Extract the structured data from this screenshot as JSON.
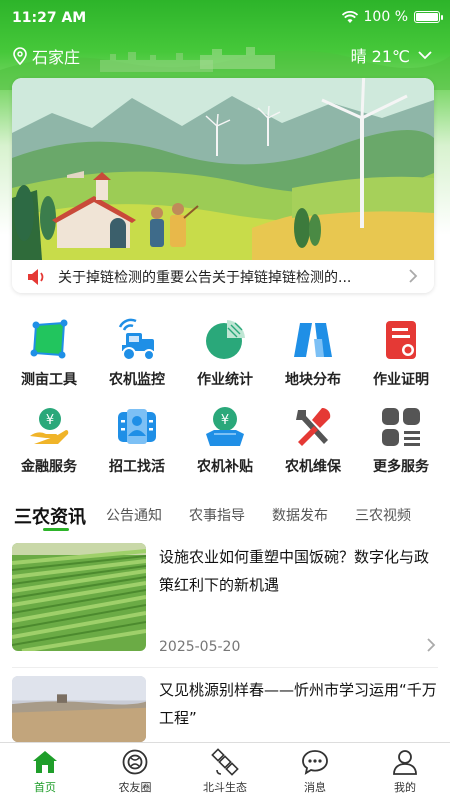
{
  "status_bar": {
    "time": "11:27 AM",
    "battery": "100 %"
  },
  "location": {
    "city": "石家庄",
    "weather": "晴 21℃"
  },
  "banner": {
    "notice_text": "关于掉链检测的重要公告关于掉链掉链检测的..."
  },
  "services": [
    {
      "label": "测亩工具",
      "icon": "field-measure-icon"
    },
    {
      "label": "农机监控",
      "icon": "tractor-monitor-icon"
    },
    {
      "label": "作业统计",
      "icon": "pie-chart-icon"
    },
    {
      "label": "地块分布",
      "icon": "plot-map-icon"
    },
    {
      "label": "作业证明",
      "icon": "certificate-icon"
    },
    {
      "label": "金融服务",
      "icon": "finance-icon"
    },
    {
      "label": "招工找活",
      "icon": "recruit-icon"
    },
    {
      "label": "农机补贴",
      "icon": "subsidy-icon"
    },
    {
      "label": "农机维保",
      "icon": "repair-tools-icon"
    },
    {
      "label": "更多服务",
      "icon": "more-services-icon"
    }
  ],
  "news_tabs": [
    "三农资讯",
    "公告通知",
    "农事指导",
    "数据发布",
    "三农视频"
  ],
  "news": [
    {
      "title": "设施农业如何重塑中国饭碗？数字化与政策红利下的新机遇",
      "date": "2025-05-20"
    },
    {
      "title": "又见桃源别样春——忻州市学习运用“千万工程”",
      "date": ""
    }
  ],
  "bottom_nav": [
    {
      "label": "首页",
      "icon": "home-icon",
      "active": true
    },
    {
      "label": "农友圈",
      "icon": "circle-icon",
      "active": false
    },
    {
      "label": "北斗生态",
      "icon": "satellite-icon",
      "active": false
    },
    {
      "label": "消息",
      "icon": "message-icon",
      "active": false
    },
    {
      "label": "我的",
      "icon": "user-icon",
      "active": false
    }
  ],
  "colors": {
    "brand_green": "#2db42a",
    "accent_red": "#e53935",
    "icon_blue": "#1f8fe6",
    "icon_teal": "#2aa87a",
    "text_dark": "#222222"
  }
}
